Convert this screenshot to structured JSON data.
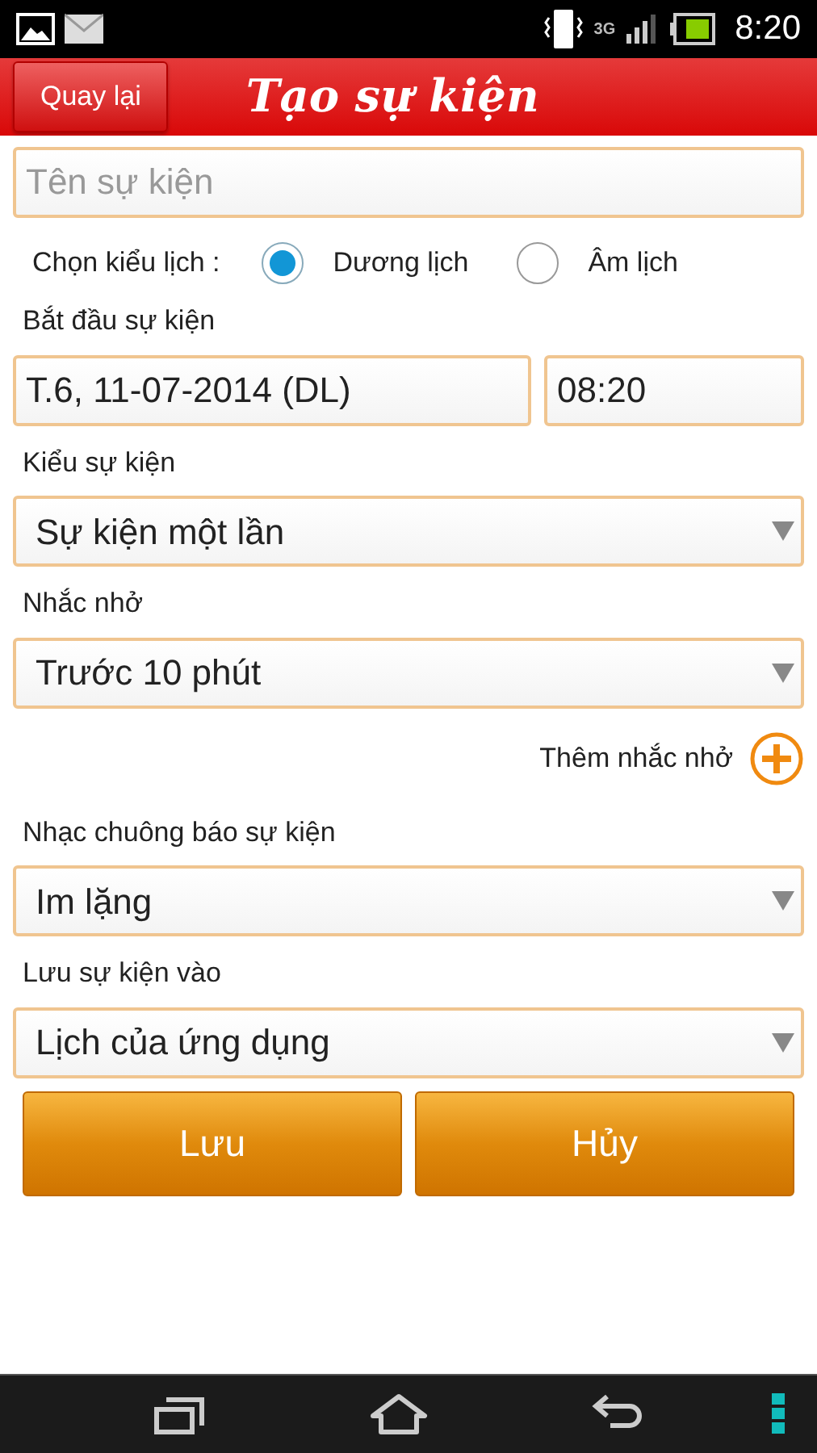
{
  "status_bar": {
    "network": "3G",
    "time": "8:20"
  },
  "header": {
    "back_button": "Quay lại",
    "title": "Tạo sự kiện"
  },
  "event_name": {
    "placeholder": "Tên sự kiện"
  },
  "calendar_type": {
    "label": "Chọn kiểu lịch :",
    "options": [
      {
        "label": "Dương lịch",
        "selected": true
      },
      {
        "label": "Âm lịch",
        "selected": false
      }
    ]
  },
  "start": {
    "label": "Bắt đầu sự kiện",
    "date": "T.6, 11-07-2014 (DL)",
    "time": "08:20"
  },
  "event_type": {
    "label": "Kiểu sự kiện",
    "value": "Sự kiện một lần"
  },
  "reminder": {
    "label": "Nhắc nhở",
    "value": "Trước 10 phút",
    "add_link": "Thêm nhắc nhở"
  },
  "ringtone": {
    "label": "Nhạc chuông báo sự kiện",
    "value": "Im lặng"
  },
  "save_to": {
    "label": "Lưu sự kiện vào",
    "value": "Lịch của ứng dụng"
  },
  "buttons": [
    "Lưu",
    "Hủy"
  ]
}
